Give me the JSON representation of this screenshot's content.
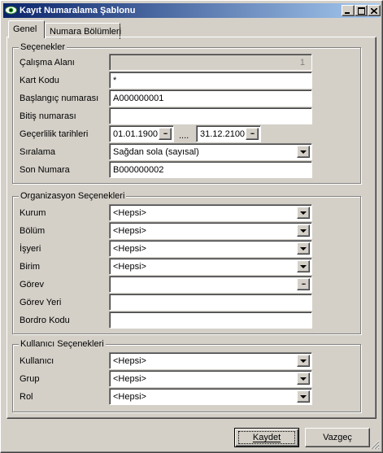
{
  "window": {
    "title": "Kayıt Numaralama Şablonu",
    "colors": {
      "titlebar_start": "#0a246a",
      "titlebar_end": "#a6caf0",
      "face": "#d4d0c8"
    },
    "icons": {
      "app": "eye-icon",
      "minimize": "minimize-icon",
      "maximize": "maximize-icon",
      "close": "close-icon"
    }
  },
  "tabs": [
    {
      "label": "Genel",
      "active": true
    },
    {
      "label": "Numara Bölümleri",
      "active": false
    }
  ],
  "secenekler": {
    "title": "Seçenekler",
    "calisma_alani": {
      "label": "Çalışma Alanı",
      "value": "1"
    },
    "kart_kodu": {
      "label": "Kart Kodu",
      "value": "*"
    },
    "baslangic": {
      "label": "Başlangıç numarası",
      "value": "A000000001"
    },
    "bitis": {
      "label": "Bitiş numarası",
      "value": ""
    },
    "gecerlilik": {
      "label": "Geçerlilik tarihleri",
      "start": "01.01.1900",
      "separator": "....",
      "end": "31.12.2100"
    },
    "siralama": {
      "label": "Sıralama",
      "value": "Sağdan sola (sayısal)"
    },
    "son_numara": {
      "label": "Son Numara",
      "value": "B000000002"
    }
  },
  "organizasyon": {
    "title": "Organizasyon Seçenekleri",
    "kurum": {
      "label": "Kurum",
      "value": "<Hepsi>"
    },
    "bolum": {
      "label": "Bölüm",
      "value": "<Hepsi>"
    },
    "isyeri": {
      "label": "İşyeri",
      "value": "<Hepsi>"
    },
    "birim": {
      "label": "Birim",
      "value": "<Hepsi>"
    },
    "gorev": {
      "label": "Görev",
      "value": ""
    },
    "gorev_yeri": {
      "label": "Görev Yeri",
      "value": ""
    },
    "bordro_kodu": {
      "label": "Bordro Kodu",
      "value": ""
    }
  },
  "kullanici": {
    "title": "Kullanıcı Seçenekleri",
    "kullanici": {
      "label": "Kullanıcı",
      "value": "<Hepsi>"
    },
    "grup": {
      "label": "Grup",
      "value": "<Hepsi>"
    },
    "rol": {
      "label": "Rol",
      "value": "<Hepsi>"
    }
  },
  "buttons": {
    "ellipsis": "...",
    "save": "Kaydet",
    "cancel": "Vazgeç"
  }
}
